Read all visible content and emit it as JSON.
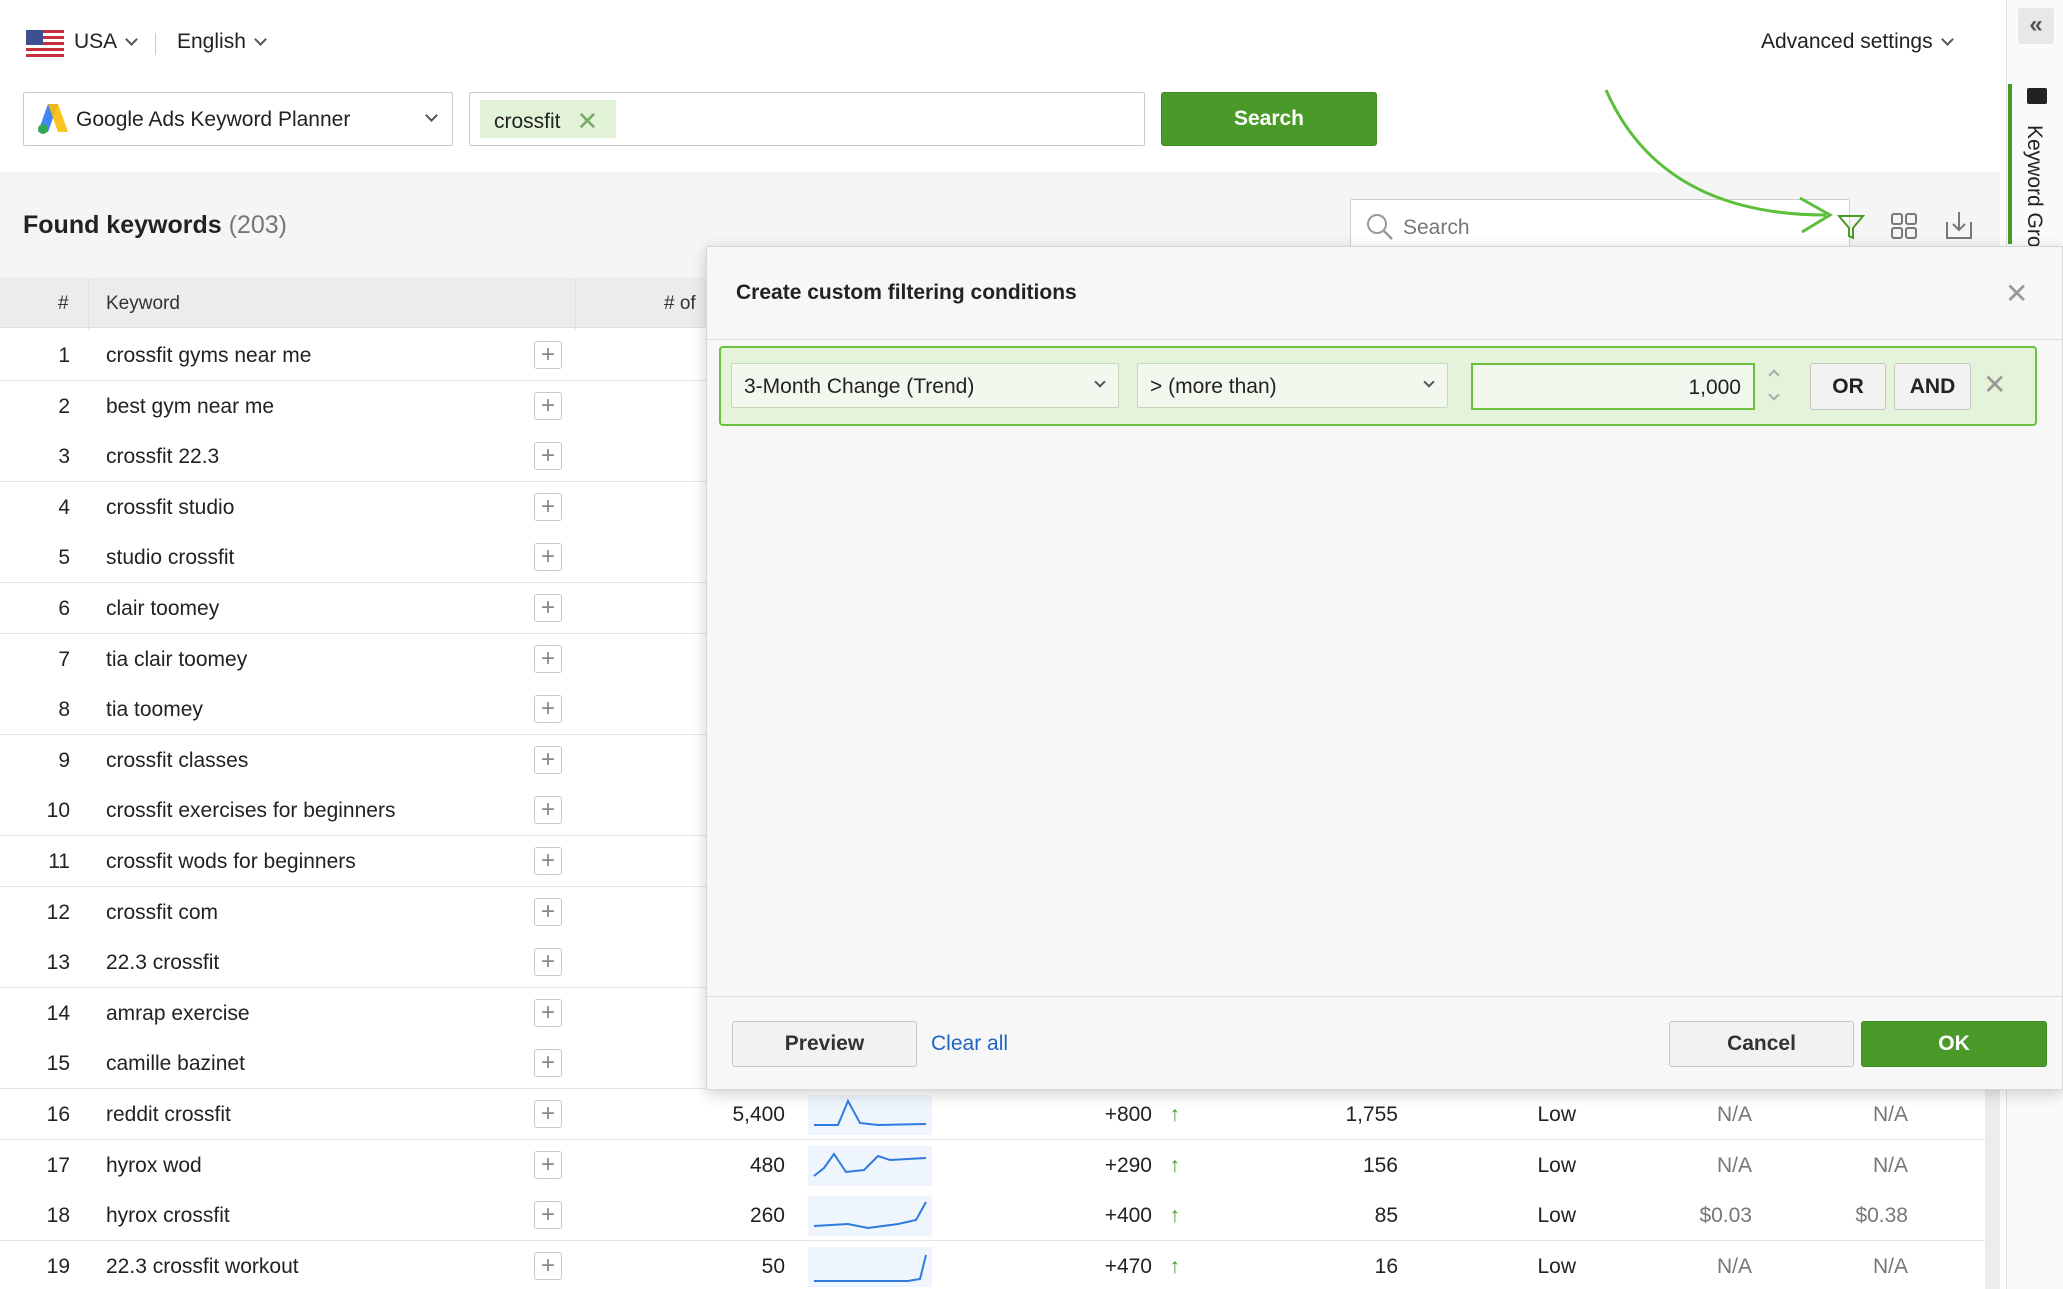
{
  "topbar": {
    "country": "USA",
    "language": "English",
    "advanced_settings": "Advanced settings"
  },
  "source": {
    "label": "Google Ads Keyword Planner",
    "icon": "google-ads-icon"
  },
  "query": {
    "tag": "crossfit"
  },
  "search_button": "Search",
  "found": {
    "title": "Found keywords",
    "count": "(203)"
  },
  "filter_search": {
    "placeholder": "Search"
  },
  "table": {
    "headers": {
      "num": "#",
      "keyword": "Keyword",
      "searches": "# of"
    },
    "rows": [
      {
        "n": "1",
        "kw": "crossfit gyms near me"
      },
      {
        "n": "2",
        "kw": "best gym near me"
      },
      {
        "n": "3",
        "kw": "crossfit 22.3"
      },
      {
        "n": "4",
        "kw": "crossfit studio"
      },
      {
        "n": "5",
        "kw": "studio crossfit"
      },
      {
        "n": "6",
        "kw": "clair toomey"
      },
      {
        "n": "7",
        "kw": "tia clair toomey"
      },
      {
        "n": "8",
        "kw": "tia toomey"
      },
      {
        "n": "9",
        "kw": "crossfit classes"
      },
      {
        "n": "10",
        "kw": "crossfit exercises for beginners"
      },
      {
        "n": "11",
        "kw": "crossfit wods for beginners"
      },
      {
        "n": "12",
        "kw": "crossfit com"
      },
      {
        "n": "13",
        "kw": "22.3 crossfit"
      },
      {
        "n": "14",
        "kw": "amrap exercise"
      },
      {
        "n": "15",
        "kw": "camille bazinet"
      },
      {
        "n": "16",
        "kw": "reddit crossfit",
        "searches": "5,400",
        "change": "+800",
        "c1": "1,755",
        "comp": "Low",
        "c2": "N/A",
        "c3": "N/A"
      },
      {
        "n": "17",
        "kw": "hyrox wod",
        "searches": "480",
        "change": "+290",
        "c1": "156",
        "comp": "Low",
        "c2": "N/A",
        "c3": "N/A"
      },
      {
        "n": "18",
        "kw": "hyrox crossfit",
        "searches": "260",
        "change": "+400",
        "c1": "85",
        "comp": "Low",
        "c2": "$0.03",
        "c3": "$0.38"
      },
      {
        "n": "19",
        "kw": "22.3 crossfit workout",
        "searches": "50",
        "change": "+470",
        "c1": "16",
        "comp": "Low",
        "c2": "N/A",
        "c3": "N/A"
      }
    ]
  },
  "right_panel": {
    "label": "Keyword Gro",
    "collapse": "«"
  },
  "modal": {
    "title": "Create custom filtering conditions",
    "condition": {
      "field": "3-Month Change (Trend)",
      "operator": "> (more than)",
      "value": "1,000"
    },
    "or_label": "OR",
    "and_label": "AND",
    "preview": "Preview",
    "clear_all": "Clear all",
    "cancel": "Cancel",
    "ok": "OK"
  },
  "colors": {
    "accent_green": "#4a9a2a",
    "link_blue": "#1f64c4",
    "tag_bg": "#e3f3d8"
  }
}
